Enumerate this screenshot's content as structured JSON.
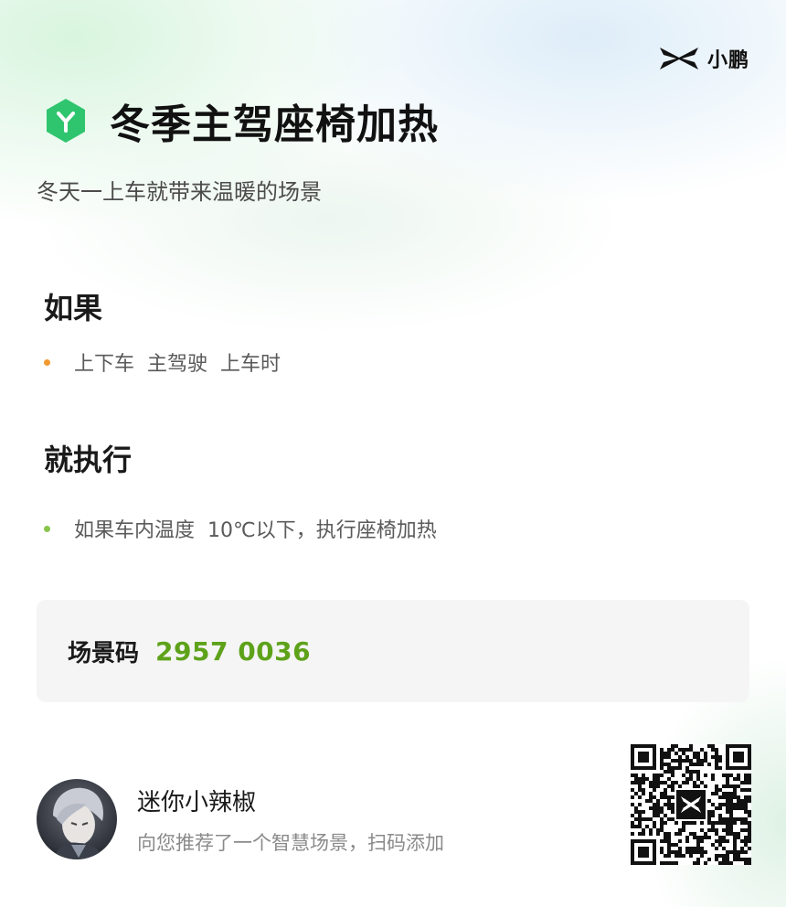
{
  "brand": {
    "name": "小鹏",
    "icon": "xpeng-logo-icon"
  },
  "scene": {
    "icon": "hexagon-y-icon",
    "title": "冬季主驾座椅加热",
    "subtitle": "冬天一上车就带来温暖的场景"
  },
  "condition": {
    "heading": "如果",
    "items": [
      {
        "text": "上下车  主驾驶  上车时"
      }
    ]
  },
  "action": {
    "heading": "就执行",
    "items": [
      {
        "text": "如果车内温度  10℃以下，执行座椅加热"
      }
    ]
  },
  "scene_code": {
    "label": "场景码",
    "value": "2957 0036"
  },
  "sharer": {
    "name": "迷你小辣椒",
    "message": "向您推荐了一个智慧场景，扫码添加",
    "avatar": "avatar-image"
  },
  "qr_code": {
    "icon": "qr-code-icon",
    "center_icon": "xpeng-logo-icon"
  },
  "colors": {
    "accent_green": "#5ea21a",
    "badge_green": "#2fc56e",
    "trigger_dot": "#f29a2e",
    "action_dot": "#8ac44b",
    "card_bg": "#f5f5f5"
  }
}
